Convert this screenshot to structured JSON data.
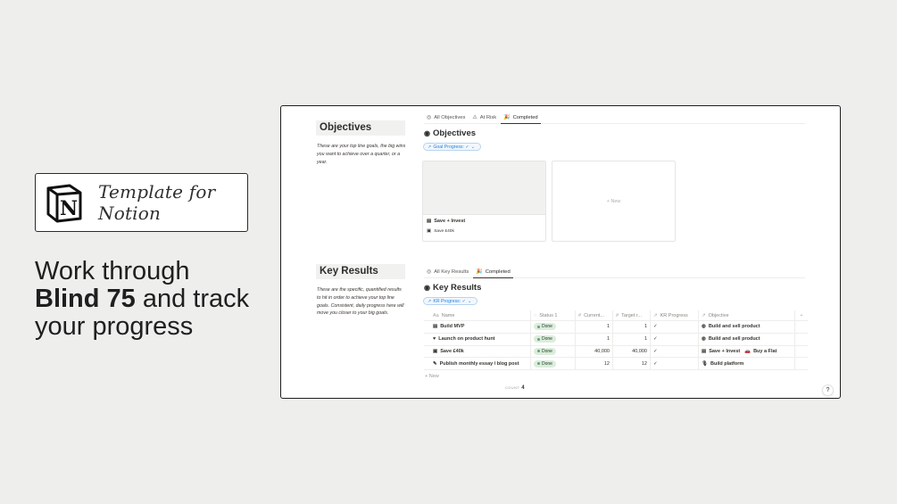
{
  "badge": {
    "text": "Template for Notion",
    "logo_icon": "notion-logo-icon"
  },
  "headline": {
    "line1": "Work through",
    "bold": "Blind 75",
    "rest": " and track",
    "line3": "your progress"
  },
  "objectives": {
    "side_title": "Objectives",
    "side_desc": "These are your top line goals, the big wins you want to achieve over a quarter, or a year.",
    "tabs": [
      {
        "icon": "◎",
        "label": "All Objectives"
      },
      {
        "icon": "⚠",
        "label": "At Risk"
      },
      {
        "icon": "🎉",
        "label": "Completed"
      }
    ],
    "db_title": "Objectives",
    "filter": "Goal Progress: ✓",
    "card": {
      "name": "Save + Invest",
      "prop": "Save £40k"
    },
    "new_label": "+ New"
  },
  "key_results": {
    "side_title": "Key Results",
    "side_desc": "These are the specific, quantified results to hit in order to achieve your top line goals. Consistent, daily progress here will move you closer to your big goals.",
    "tabs": [
      {
        "icon": "◎",
        "label": "All Key Results"
      },
      {
        "icon": "🎉",
        "label": "Completed"
      }
    ],
    "db_title": "Key Results",
    "filter": "KR Progress: ✓",
    "columns": {
      "name": "Name",
      "status": "Status 1",
      "current": "Current...",
      "target": "Target r...",
      "kr": "KR Progress",
      "objective": "Objective",
      "plus": "+"
    },
    "rows": [
      {
        "icon": "▤",
        "name": "Build MVP",
        "status": "Done",
        "current": "1",
        "target": "1",
        "kr": "✓",
        "objectives": [
          {
            "icon": "◍",
            "label": "Build and sell product"
          }
        ]
      },
      {
        "icon": "♥",
        "name": "Launch on product hunt",
        "status": "Done",
        "current": "1",
        "target": "1",
        "kr": "✓",
        "objectives": [
          {
            "icon": "◍",
            "label": "Build and sell product"
          }
        ]
      },
      {
        "icon": "▣",
        "name": "Save £40k",
        "status": "Done",
        "current": "40,000",
        "target": "40,000",
        "kr": "✓",
        "objectives": [
          {
            "icon": "▤",
            "label": "Save + Invest"
          },
          {
            "icon": "🚗",
            "label": "Buy a Flat"
          }
        ]
      },
      {
        "icon": "✎",
        "name": "Publish monthly essay / blog post",
        "status": "Done",
        "current": "12",
        "target": "12",
        "kr": "✓",
        "objectives": [
          {
            "icon": "🎙",
            "label": "Build platform"
          }
        ]
      }
    ],
    "new_label": "+ New",
    "count_label": "COUNT",
    "count_value": "4"
  },
  "help": "?"
}
